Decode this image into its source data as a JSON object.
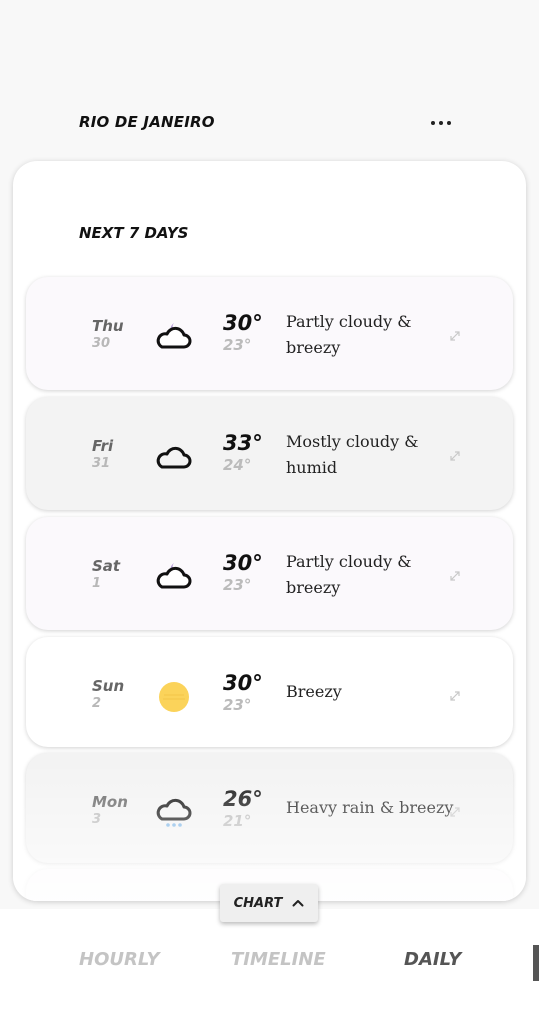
{
  "header": {
    "city": "RIO DE JANEIRO",
    "menu_icon": "more-horizontal-icon"
  },
  "forecast": {
    "title": "NEXT 7 DAYS",
    "days": [
      {
        "day": "Thu",
        "date": "30",
        "hi": "30°",
        "lo": "23°",
        "desc": "Partly cloudy & breezy",
        "icon": "partly-cloudy-icon"
      },
      {
        "day": "Fri",
        "date": "31",
        "hi": "33°",
        "lo": "24°",
        "desc": "Mostly cloudy & humid",
        "icon": "cloudy-icon"
      },
      {
        "day": "Sat",
        "date": "1",
        "hi": "30°",
        "lo": "23°",
        "desc": "Partly cloudy & breezy",
        "icon": "partly-cloudy-icon"
      },
      {
        "day": "Sun",
        "date": "2",
        "hi": "30°",
        "lo": "23°",
        "desc": "Breezy",
        "icon": "sun-icon"
      },
      {
        "day": "Mon",
        "date": "3",
        "hi": "26°",
        "lo": "21°",
        "desc": "Heavy rain & breezy",
        "icon": "rain-icon"
      }
    ]
  },
  "chart_button": {
    "label": "CHART",
    "icon": "chevron-up-icon"
  },
  "tabs": [
    {
      "label": "HOURLY",
      "active": false
    },
    {
      "label": "TIMELINE",
      "active": false
    },
    {
      "label": "DAILY",
      "active": true
    }
  ],
  "colors": {
    "row_tint": "#fbf9fc",
    "row_grey": "#f3f3f3",
    "moon_purple": "#b49ad6",
    "sun_yellow": "#fbd35a",
    "rain_blue": "#7fb6e6"
  }
}
